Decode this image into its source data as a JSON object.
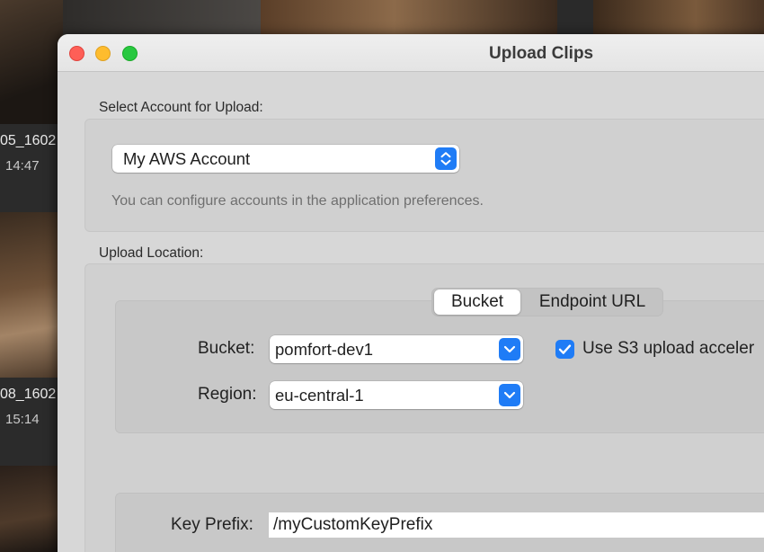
{
  "background": {
    "thumbnails": [
      {
        "name": "05_1602",
        "time": "14:47"
      },
      {
        "name": "08_1602",
        "time": "15:14"
      }
    ]
  },
  "window": {
    "title": "Upload Clips",
    "account_section": {
      "label": "Select Account for Upload:",
      "account_value": "My AWS Account",
      "hint": "You can configure accounts in the application preferences."
    },
    "location_section": {
      "label": "Upload Location:",
      "tabs": [
        "Bucket",
        "Endpoint URL"
      ],
      "selected_tab": "Bucket",
      "bucket_label": "Bucket:",
      "bucket_value": "pomfort-dev1",
      "region_label": "Region:",
      "region_value": "eu-central-1",
      "accel_label": "Use S3 upload acceler",
      "accel_checked": true
    },
    "key_prefix": {
      "label": "Key Prefix:",
      "value": "/myCustomKeyPrefix"
    }
  },
  "colors": {
    "accent": "#1f7cf6",
    "close": "#fe5f57",
    "minimize": "#febc2e",
    "zoom": "#28c840"
  }
}
